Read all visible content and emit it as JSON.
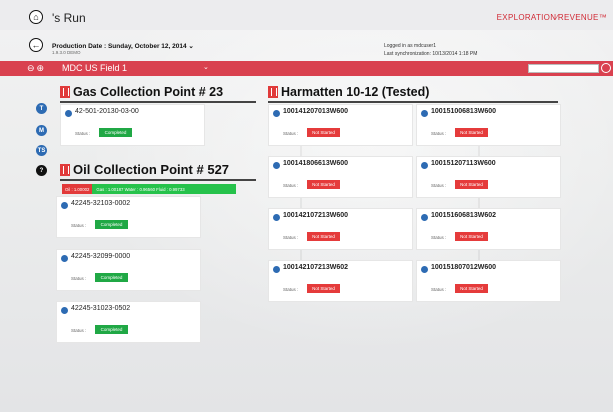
{
  "app": {
    "title": "'s Run",
    "brand": "EXPLORATION∕REVENUE™",
    "production_date": "Production Date : Sunday, October 12, 2014 ⌄",
    "version": "1.9.3.0 DEMO",
    "logged_in": "Logged in as  mdcuser1",
    "last_sync": "Last synchronization: 10/13/2014 1:18 PM"
  },
  "field": {
    "name": "MDC US Field 1",
    "caret": "⌄"
  },
  "sidebar": [
    {
      "label": "T"
    },
    {
      "label": "M"
    },
    {
      "label": "TS"
    },
    {
      "label": "?"
    }
  ],
  "gas_point": {
    "title": "Gas Collection Point # 23",
    "wells": [
      {
        "id": "42-501-20130-03-00",
        "status_label": "Status :",
        "status": "Completed"
      }
    ]
  },
  "oil_point": {
    "title": "Oil Collection Point # 527",
    "oil_label": "Oil : 1.00002",
    "summary": "Gas : 1.00187   Water : 0.96560   Fluid : 0.99733",
    "wells": [
      {
        "id": "42245-32103-0002",
        "status_label": "Status :",
        "status": "Completed"
      },
      {
        "id": "42245-32099-0000",
        "status_label": "Status :",
        "status": "Completed"
      },
      {
        "id": "42245-31023-0502",
        "status_label": "Status :",
        "status": "Completed"
      }
    ]
  },
  "harmatten": {
    "title": "Harmatten 10-12 (Tested)",
    "wells": [
      {
        "id": "100141207013W600",
        "status_label": "Status :",
        "status": "Not Started"
      },
      {
        "id": "100151006813W600",
        "status_label": "Status :",
        "status": "Not Started"
      },
      {
        "id": "100141806613W600",
        "status_label": "Status :",
        "status": "Not Started"
      },
      {
        "id": "100151207113W600",
        "status_label": "Status :",
        "status": "Not Started"
      },
      {
        "id": "100142107213W600",
        "status_label": "Status :",
        "status": "Not Started"
      },
      {
        "id": "100151606813W602",
        "status_label": "Status :",
        "status": "Not Started"
      },
      {
        "id": "100142107213W602",
        "status_label": "Status :",
        "status": "Not Started"
      },
      {
        "id": "100151807012W600",
        "status_label": "Status :",
        "status": "Not Started"
      }
    ]
  },
  "colors": {
    "accent": "#d9414f",
    "completed": "#20a845",
    "not_started": "#e53b3b",
    "icon_blue": "#2d6bb3"
  }
}
